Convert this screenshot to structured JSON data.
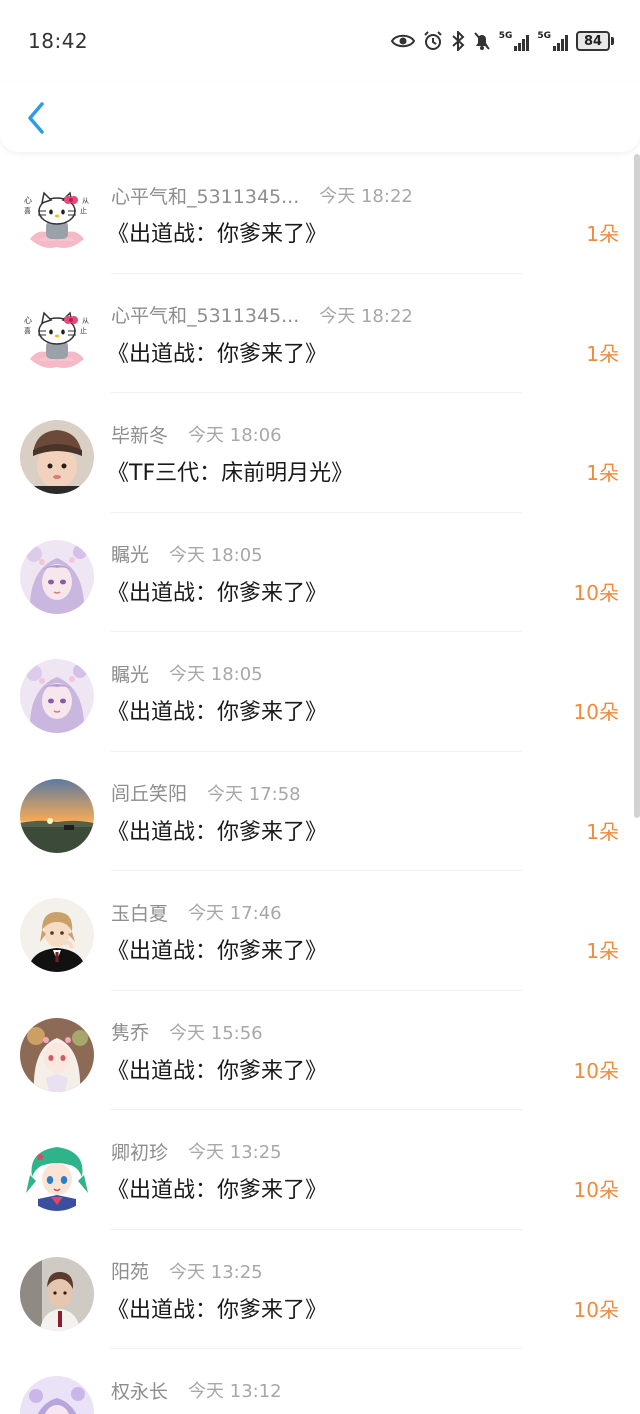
{
  "status_bar": {
    "time": "18:42",
    "network_label_1": "5G",
    "network_label_2": "5G",
    "battery": "84"
  },
  "header": {
    "back_icon": "chevron-left-icon",
    "accent_color": "#2f9bea"
  },
  "colors": {
    "flower_count": "#f08a3c"
  },
  "items": [
    {
      "user": "心平气和_5311345...",
      "time": "今天 18:22",
      "title": "《出道战：你爹来了》",
      "count": "1朵",
      "avatar": "hello-kitty-avatar"
    },
    {
      "user": "心平气和_5311345...",
      "time": "今天 18:22",
      "title": "《出道战：你爹来了》",
      "count": "1朵",
      "avatar": "hello-kitty-avatar"
    },
    {
      "user": "毕新冬",
      "time": "今天 18:06",
      "title": "《TF三代：床前明月光》",
      "count": "1朵",
      "avatar": "child-photo-avatar"
    },
    {
      "user": "瞩光",
      "time": "今天 18:05",
      "title": "《出道战：你爹来了》",
      "count": "10朵",
      "avatar": "anime-girl-purple-avatar"
    },
    {
      "user": "瞩光",
      "time": "今天 18:05",
      "title": "《出道战：你爹来了》",
      "count": "10朵",
      "avatar": "anime-girl-purple-avatar"
    },
    {
      "user": "闾丘笑阳",
      "time": "今天 17:58",
      "title": "《出道战：你爹来了》",
      "count": "1朵",
      "avatar": "sunset-landscape-avatar"
    },
    {
      "user": "玉白夏",
      "time": "今天 17:46",
      "title": "《出道战：你爹来了》",
      "count": "1朵",
      "avatar": "anime-boy-suit-avatar"
    },
    {
      "user": "隽乔",
      "time": "今天 15:56",
      "title": "《出道战：你爹来了》",
      "count": "10朵",
      "avatar": "anime-girl-white-hair-avatar"
    },
    {
      "user": "卿初珍",
      "time": "今天 13:25",
      "title": "《出道战：你爹来了》",
      "count": "10朵",
      "avatar": "anime-girl-green-hair-avatar"
    },
    {
      "user": "阳苑",
      "time": "今天 13:25",
      "title": "《出道战：你爹来了》",
      "count": "10朵",
      "avatar": "portrait-photo-avatar"
    },
    {
      "user": "权永长",
      "time": "今天 13:12",
      "title": "",
      "count": "",
      "avatar": "anime-girl-lavender-avatar"
    }
  ]
}
